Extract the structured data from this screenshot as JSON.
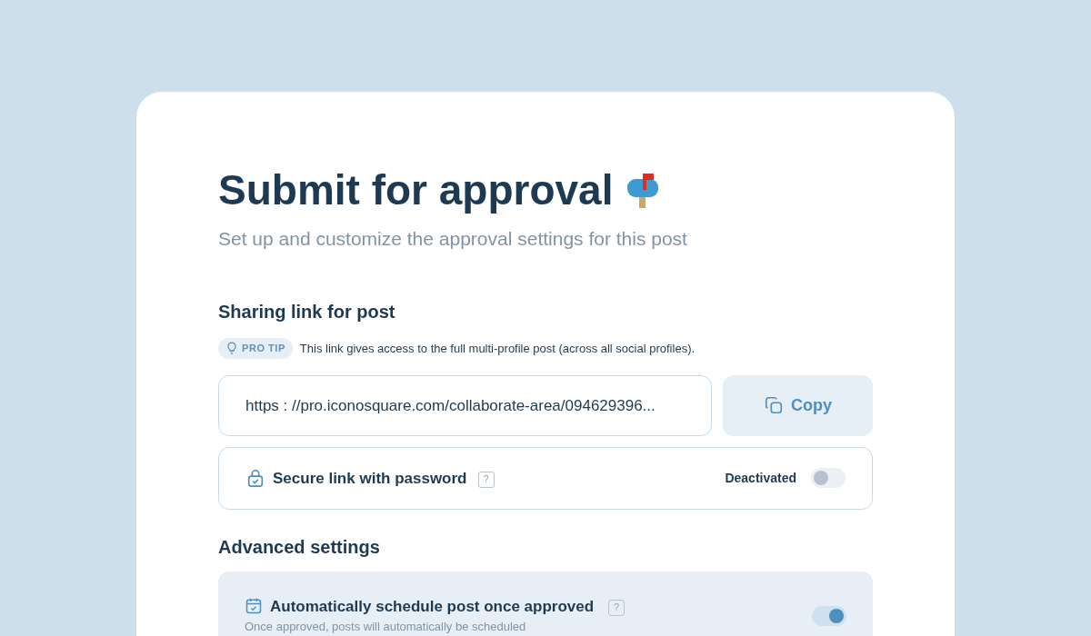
{
  "title": "Submit for approval",
  "subtitle": "Set up and customize the approval settings for this post",
  "sharing": {
    "heading": "Sharing link for post",
    "tip_badge": "PRO TIP",
    "tip_text": "This link gives access to the full multi-profile post (across all social profiles).",
    "link": "https : //pro.iconosquare.com/collaborate-area/094629396...",
    "copy_label": "Copy",
    "password": {
      "label": "Secure link with password",
      "help": "?",
      "status": "Deactivated",
      "on": false
    }
  },
  "advanced": {
    "heading": "Advanced settings",
    "items": [
      {
        "label": "Automatically schedule post once approved",
        "help": "?",
        "description": "Once approved, posts will automatically be scheduled",
        "on": true
      }
    ]
  }
}
